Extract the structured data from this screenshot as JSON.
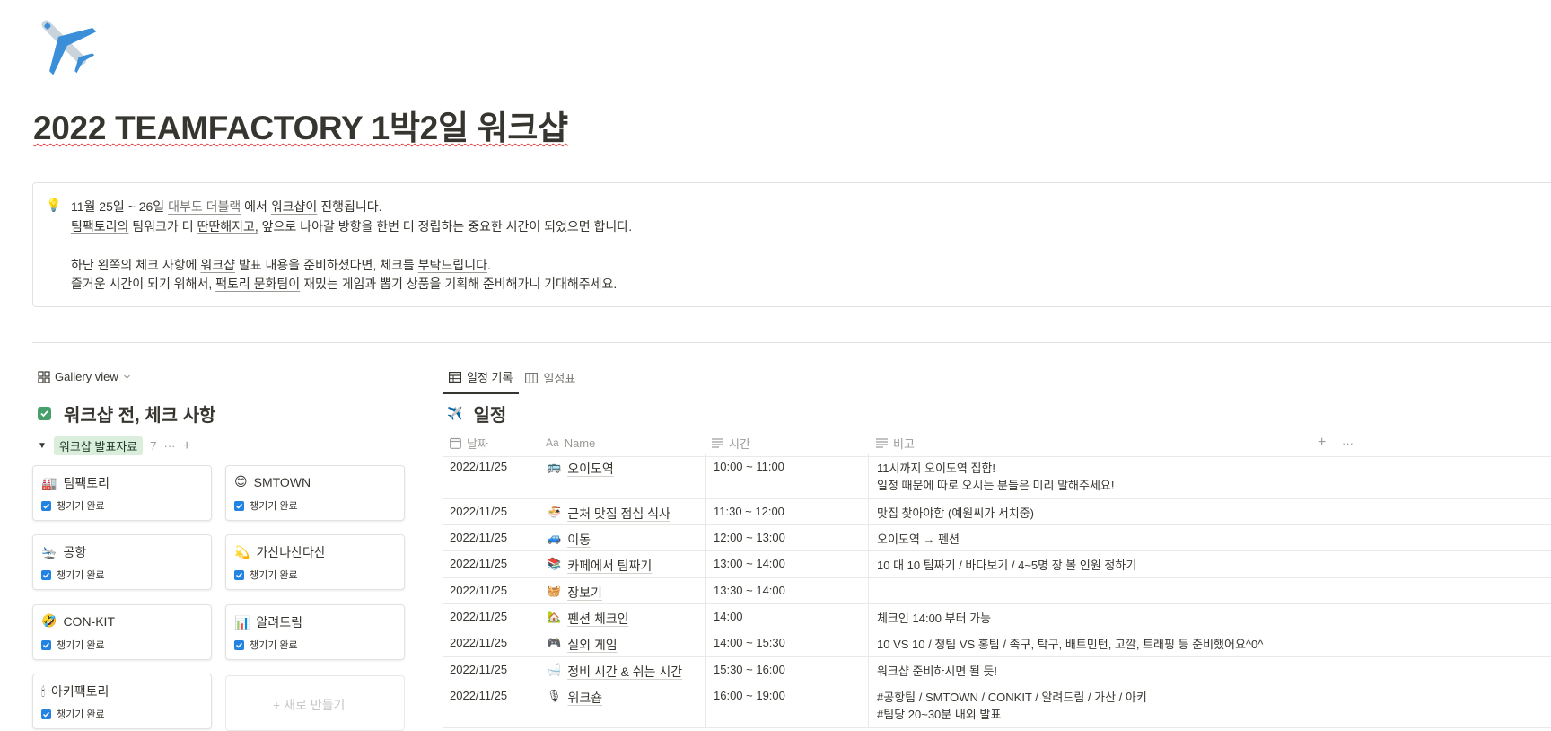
{
  "page": {
    "icon": "airplane-icon",
    "title": "2022 TEAMFACTORY 1박2일 워크샵"
  },
  "callout": {
    "icon": "💡",
    "line1_pre": "11월 25일 ~ 26일 ",
    "line1_mention": "대부도 더블랙",
    "line1_mid": " 에서 ",
    "line1_u": "워크샵이",
    "line1_post": " 진행됩니다.",
    "line2_u1": "팀팩토리의",
    "line2_mid1": " 팀워크가 더 ",
    "line2_u2": "딴딴해지고,",
    "line2_post": " 앞으로 나아갈 방향을 한번 더 정립하는 중요한 시간이 되었으면 합니다.",
    "line3_pre": "하단 왼쪽의 체크 사항에 ",
    "line3_u1": "워크샵",
    "line3_mid": " 발표 내용을 준비하셨다면, 체크를 ",
    "line3_u2": "부탁드립니다",
    "line3_post": ".",
    "line4_pre": "즐거운 시간이 되기 위해서, ",
    "line4_u1": "팩토리 문화팀이",
    "line4_post": " 재밌는 게임과 뽑기 상품을 기획해 준비해가니 기대해주세요."
  },
  "gallery": {
    "view_label": "Gallery view",
    "title": "워크샵 전, 체크 사항",
    "group_tag": "워크샵 발표자료",
    "group_count": "7",
    "more": "···",
    "add": "+",
    "check_label": "챙기기 완료",
    "cards": [
      {
        "emoji": "🏭",
        "name": "팀팩토리"
      },
      {
        "emoji": "😊",
        "name": "SMTOWN"
      },
      {
        "emoji": "🛬",
        "name": "공항"
      },
      {
        "emoji": "💫",
        "name": "가산나산다산"
      },
      {
        "emoji": "🤣",
        "name": "CON-KIT"
      },
      {
        "emoji": "📊",
        "name": "알려드림"
      },
      {
        "emoji": "🕯",
        "name": "아키팩토리"
      }
    ],
    "new_label": "+ 새로 만들기"
  },
  "schedule": {
    "tabs": [
      "일정 기록",
      "일정표"
    ],
    "title": "일정",
    "columns": {
      "date": "날짜",
      "name": "Name",
      "time": "시간",
      "note": "비고"
    },
    "rows": [
      {
        "date": "2022/11/25",
        "emoji": "🚌",
        "name": "오이도역",
        "time": "10:00 ~ 11:00",
        "note1": "11시까지 오이도역 집합!",
        "note2": "일정 때문에 따로 오시는 분들은 미리 말해주세요!"
      },
      {
        "date": "2022/11/25",
        "emoji": "🍜",
        "name": "근처 맛집 점심 식사",
        "time": "11:30 ~ 12:00",
        "note1": "맛집 찾아야함 (예원씨가 서치중)",
        "note2": ""
      },
      {
        "date": "2022/11/25",
        "emoji": "🚙",
        "name": "이동",
        "time": "12:00 ~ 13:00",
        "note1": "오이도역 → 펜션",
        "note2": ""
      },
      {
        "date": "2022/11/25",
        "emoji": "📚",
        "name": "카페에서 팀짜기",
        "time": "13:00 ~ 14:00",
        "note1": "10 대 10 팀짜기 / 바다보기 / 4~5명 장 볼 인원 정하기",
        "note2": ""
      },
      {
        "date": "2022/11/25",
        "emoji": "🧺",
        "name": "장보기",
        "time": "13:30 ~ 14:00",
        "note1": "",
        "note2": ""
      },
      {
        "date": "2022/11/25",
        "emoji": "🏡",
        "name": "펜션 체크인",
        "time": "14:00",
        "note1": "체크인 14:00 부터 가능",
        "note2": ""
      },
      {
        "date": "2022/11/25",
        "emoji": "🎮",
        "name": "실외 게임",
        "time": "14:00 ~ 15:30",
        "note1": "10 VS 10 / 청팀 VS 홍팀 / 족구, 탁구, 배트민턴, 고깔, 트래핑 등 준비했어요^0^",
        "note2": ""
      },
      {
        "date": "2022/11/25",
        "emoji": "🛁",
        "name": "정비 시간 & 쉬는 시간",
        "time": "15:30 ~ 16:00",
        "note1": "워크샵 준비하시면 될 듯!",
        "note2": ""
      },
      {
        "date": "2022/11/25",
        "emoji": "🎙",
        "name": "워크숍",
        "time": "16:00 ~ 19:00",
        "note1": "#공항팀 / SMTOWN / CONKIT / 알려드림 / 가산 / 아키",
        "note2": "#팀당 20~30분 내외 발표"
      }
    ]
  }
}
